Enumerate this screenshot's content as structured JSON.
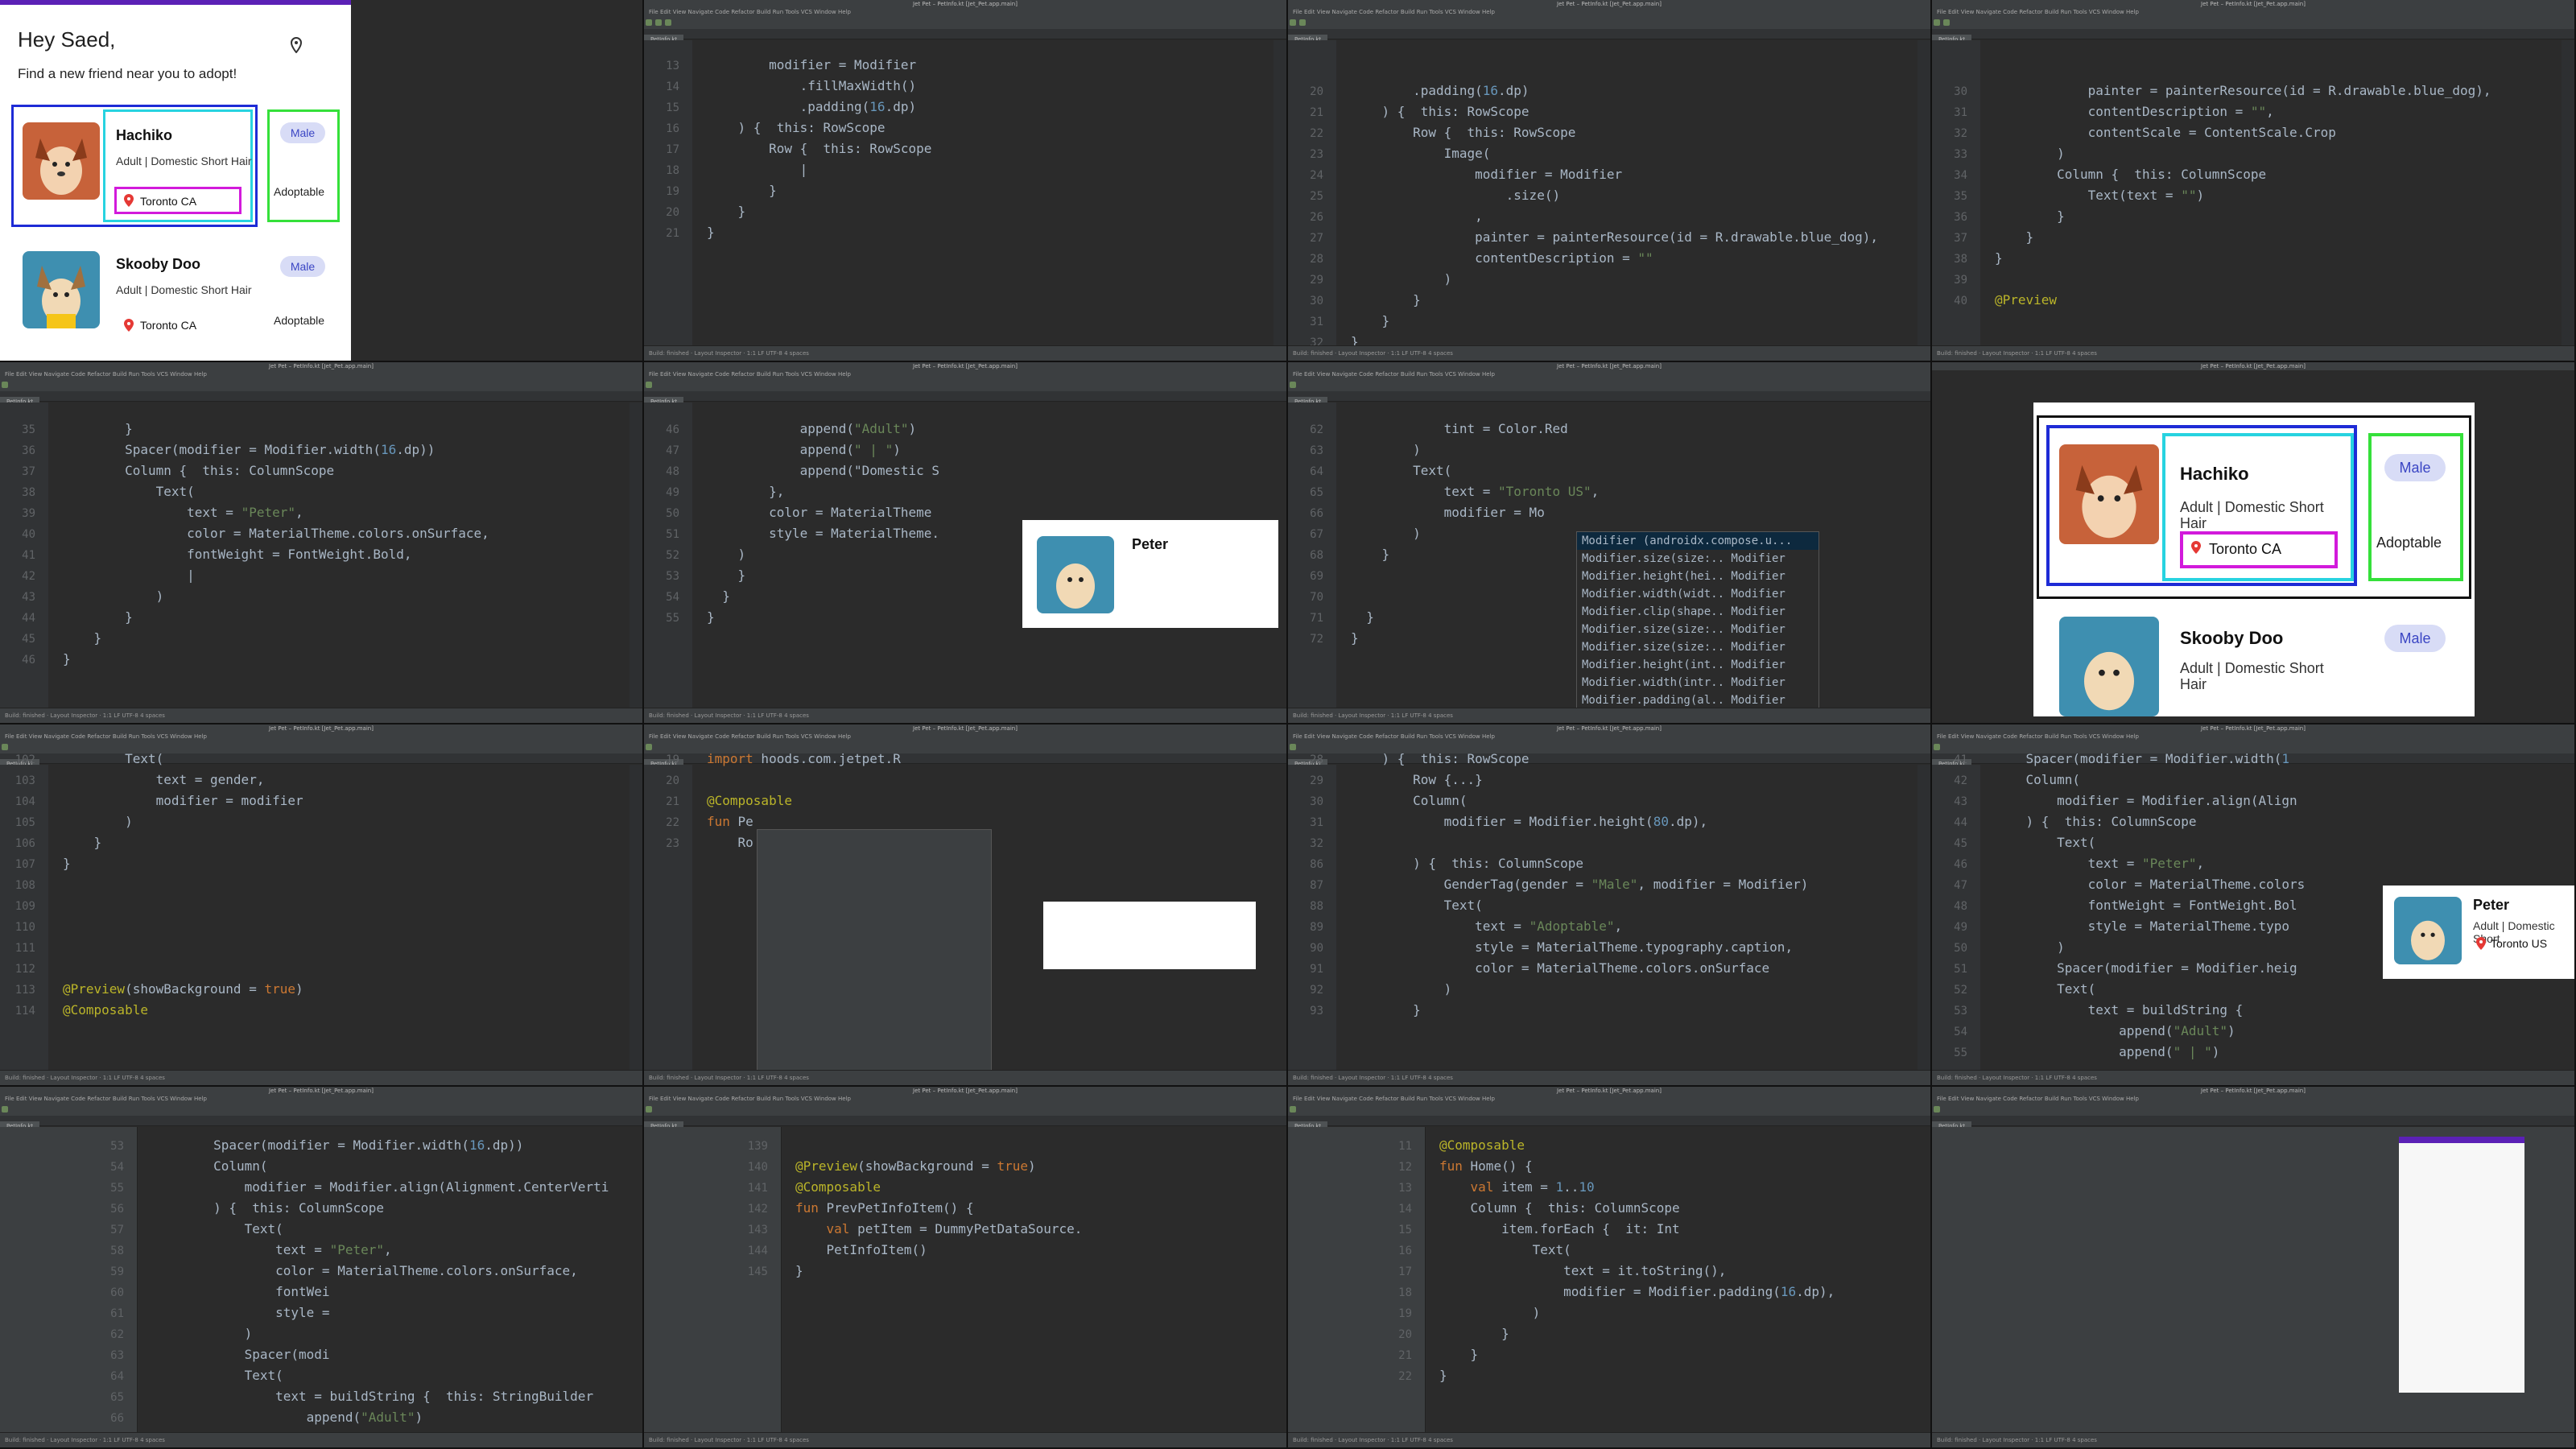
{
  "app": {
    "greeting": "Hey Saed,",
    "subtitle": "Find a new friend near you to adopt!",
    "pets": [
      {
        "name": "Hachiko",
        "desc": "Adult | Domestic Short Hair",
        "location": "Toronto CA",
        "gender": "Male",
        "status": "Adoptable"
      },
      {
        "name": "Skooby Doo",
        "desc": "Adult | Domestic Short Hair",
        "location": "Toronto CA",
        "gender": "Male",
        "status": "Adoptable"
      }
    ]
  },
  "editor": {
    "window_title": "Jet Pet – PetInfo.kt [Jet_Pet.app.main]",
    "menu": "File  Edit  View  Navigate  Code  Refactor  Build  Run  Tools  VCS  Window  Help",
    "tab": "PetInfo.kt",
    "status": "Build: finished · Layout Inspector · 1:1 LF UTF-8 4 spaces"
  },
  "panels": {
    "p1": [
      {
        "n": "13",
        "t": "        modifier = Modifier"
      },
      {
        "n": "14",
        "t": "            .fillMaxWidth()"
      },
      {
        "n": "15",
        "t": "            .padding(16.dp)"
      },
      {
        "n": "16",
        "t": "    ) {  this: RowScope"
      },
      {
        "n": "17",
        "t": "        Row {  this: RowScope"
      },
      {
        "n": "18",
        "t": "            |"
      },
      {
        "n": "19",
        "t": "        }"
      },
      {
        "n": "20",
        "t": "    }"
      },
      {
        "n": "21",
        "t": "}"
      }
    ],
    "p2": [
      {
        "n": "20",
        "t": "        .padding(16.dp)"
      },
      {
        "n": "21",
        "t": "    ) {  this: RowScope"
      },
      {
        "n": "22",
        "t": "        Row {  this: RowScope"
      },
      {
        "n": "23",
        "t": "            Image("
      },
      {
        "n": "24",
        "t": "                modifier = Modifier"
      },
      {
        "n": "25",
        "t": "                    .size()"
      },
      {
        "n": "26",
        "t": "                ,"
      },
      {
        "n": "27",
        "t": "                painter = painterResource(id = R.drawable.blue_dog),"
      },
      {
        "n": "28",
        "t": "                contentDescription = \"\""
      },
      {
        "n": "29",
        "t": "            )"
      },
      {
        "n": "30",
        "t": "        }"
      },
      {
        "n": "31",
        "t": "    }"
      },
      {
        "n": "32",
        "t": "}"
      }
    ],
    "p3": [
      {
        "n": "30",
        "t": "            painter = painterResource(id = R.drawable.blue_dog),"
      },
      {
        "n": "31",
        "t": "            contentDescription = \"\","
      },
      {
        "n": "32",
        "t": "            contentScale = ContentScale.Crop"
      },
      {
        "n": "33",
        "t": "        )"
      },
      {
        "n": "34",
        "t": "        Column {  this: ColumnScope"
      },
      {
        "n": "35",
        "t": "            Text(text = \"\")"
      },
      {
        "n": "36",
        "t": "        }"
      },
      {
        "n": "37",
        "t": "    }"
      },
      {
        "n": "38",
        "t": "}"
      },
      {
        "n": "39",
        "t": ""
      },
      {
        "n": "40",
        "t": "@Preview"
      }
    ],
    "p4": [
      {
        "n": "35",
        "t": "        }"
      },
      {
        "n": "36",
        "t": "        Spacer(modifier = Modifier.width(16.dp))"
      },
      {
        "n": "37",
        "t": "        Column {  this: ColumnScope"
      },
      {
        "n": "38",
        "t": "            Text("
      },
      {
        "n": "39",
        "t": "                text = \"Peter\","
      },
      {
        "n": "40",
        "t": "                color = MaterialTheme.colors.onSurface,"
      },
      {
        "n": "41",
        "t": "                fontWeight = FontWeight.Bold,"
      },
      {
        "n": "42",
        "t": "                |"
      },
      {
        "n": "43",
        "t": "            )"
      },
      {
        "n": "44",
        "t": "        }"
      },
      {
        "n": "45",
        "t": "    }"
      },
      {
        "n": "46",
        "t": "}"
      }
    ],
    "p5": [
      {
        "n": "46",
        "t": "            append(\"Adult\")"
      },
      {
        "n": "47",
        "t": "            append(\" | \")"
      },
      {
        "n": "48",
        "t": "            append(\"Domestic S"
      },
      {
        "n": "49",
        "t": "        },"
      },
      {
        "n": "50",
        "t": "        color = MaterialTheme"
      },
      {
        "n": "51",
        "t": "        style = MaterialTheme."
      },
      {
        "n": "52",
        "t": "    )"
      },
      {
        "n": "53",
        "t": "    }"
      },
      {
        "n": "54",
        "t": "  }"
      },
      {
        "n": "55",
        "t": "}"
      }
    ],
    "p5_preview_name": "Peter",
    "p6": [
      {
        "n": "62",
        "t": "            tint = Color.Red"
      },
      {
        "n": "63",
        "t": "        )"
      },
      {
        "n": "64",
        "t": "        Text("
      },
      {
        "n": "65",
        "t": "            text = \"Toronto US\","
      },
      {
        "n": "66",
        "t": "            modifier = Mo"
      },
      {
        "n": "67",
        "t": "        )"
      },
      {
        "n": "68",
        "t": "    }"
      },
      {
        "n": "69",
        "t": ""
      },
      {
        "n": "70",
        "t": ""
      },
      {
        "n": "71",
        "t": "  }"
      },
      {
        "n": "72",
        "t": "}"
      }
    ],
    "p6_popup": [
      "Modifier (androidx.compose.u...",
      "Modifier.size(size:..  Modifier",
      "Modifier.height(hei..  Modifier",
      "Modifier.width(widt..  Modifier",
      "Modifier.clip(shape..  Modifier",
      "Modifier.size(size:..  Modifier",
      "Modifier.size(size:..  Modifier",
      "Modifier.height(int..  Modifier",
      "Modifier.width(intr..  Modifier",
      "Modifier.padding(al..  Modifier"
    ],
    "p7_card": {
      "name": "Hachiko",
      "desc": "Adult | Domestic Short Hair",
      "location": "Toronto CA",
      "gender": "Male",
      "status": "Adoptable",
      "name2": "Skooby Doo",
      "desc2": "Adult | Domestic Short Hair",
      "gender2": "Male"
    },
    "p8": [
      {
        "n": "102",
        "t": "        Text("
      },
      {
        "n": "103",
        "t": "            text = gender,"
      },
      {
        "n": "104",
        "t": "            modifier = modifier"
      },
      {
        "n": "105",
        "t": "        )"
      },
      {
        "n": "106",
        "t": "    }"
      },
      {
        "n": "107",
        "t": "}"
      },
      {
        "n": "108",
        "t": ""
      },
      {
        "n": "109",
        "t": ""
      },
      {
        "n": "110",
        "t": ""
      },
      {
        "n": "111",
        "t": ""
      },
      {
        "n": "112",
        "t": ""
      },
      {
        "n": "113",
        "t": "@Preview(showBackground = true)"
      },
      {
        "n": "114",
        "t": "@Composable"
      }
    ],
    "p9": [
      {
        "n": "19",
        "t": "import hoods.com.jetpet.R"
      },
      {
        "n": "20",
        "t": ""
      },
      {
        "n": "21",
        "t": "@Composable"
      },
      {
        "n": "22",
        "t": "fun Pe"
      },
      {
        "n": "23",
        "t": "    Ro"
      }
    ],
    "p10": [
      {
        "n": "28",
        "t": "    ) {  this: RowScope"
      },
      {
        "n": "29",
        "t": "        Row {...}"
      },
      {
        "n": "30",
        "t": "        Column("
      },
      {
        "n": "31",
        "t": "            modifier = Modifier.height(80.dp),"
      },
      {
        "n": "32",
        "t": ""
      },
      {
        "n": "86",
        "t": "        ) {  this: ColumnScope"
      },
      {
        "n": "87",
        "t": "            GenderTag(gender = \"Male\", modifier = Modifier)"
      },
      {
        "n": "88",
        "t": "            Text("
      },
      {
        "n": "89",
        "t": "                text = \"Adoptable\","
      },
      {
        "n": "90",
        "t": "                style = MaterialTheme.typography.caption,"
      },
      {
        "n": "91",
        "t": "                color = MaterialTheme.colors.onSurface"
      },
      {
        "n": "92",
        "t": "            )"
      },
      {
        "n": "93",
        "t": "        }"
      }
    ],
    "p11": [
      {
        "n": "41",
        "t": "    Spacer(modifier = Modifier.width(1"
      },
      {
        "n": "42",
        "t": "    Column("
      },
      {
        "n": "43",
        "t": "        modifier = Modifier.align(Align"
      },
      {
        "n": "44",
        "t": "    ) {  this: ColumnScope"
      },
      {
        "n": "45",
        "t": "        Text("
      },
      {
        "n": "46",
        "t": "            text = \"Peter\","
      },
      {
        "n": "47",
        "t": "            color = MaterialTheme.colors"
      },
      {
        "n": "48",
        "t": "            fontWeight = FontWeight.Bol"
      },
      {
        "n": "49",
        "t": "            style = MaterialTheme.typo"
      },
      {
        "n": "50",
        "t": "        )"
      },
      {
        "n": "51",
        "t": "        Spacer(modifier = Modifier.heig"
      },
      {
        "n": "52",
        "t": "        Text("
      },
      {
        "n": "53",
        "t": "            text = buildString {"
      },
      {
        "n": "54",
        "t": "                append(\"Adult\")"
      },
      {
        "n": "55",
        "t": "                append(\" | \")"
      }
    ],
    "p11_preview": {
      "name": "Peter",
      "desc": "Adult | Domestic Short",
      "location": "Toronto US"
    },
    "p12": [
      {
        "n": "53",
        "t": "        Spacer(modifier = Modifier.width(16.dp))"
      },
      {
        "n": "54",
        "t": "        Column("
      },
      {
        "n": "55",
        "t": "            modifier = Modifier.align(Alignment.CenterVerti"
      },
      {
        "n": "56",
        "t": "        ) {  this: ColumnScope"
      },
      {
        "n": "57",
        "t": "            Text("
      },
      {
        "n": "58",
        "t": "                text = \"Peter\","
      },
      {
        "n": "59",
        "t": "                color = MaterialTheme.colors.onSurface,"
      },
      {
        "n": "60",
        "t": "                fontWei"
      },
      {
        "n": "61",
        "t": "                style ="
      },
      {
        "n": "62",
        "t": "            )"
      },
      {
        "n": "63",
        "t": "            Spacer(modi"
      },
      {
        "n": "64",
        "t": "            Text("
      },
      {
        "n": "65",
        "t": "                text = buildString {  this: StringBuilder"
      },
      {
        "n": "66",
        "t": "                    append(\"Adult\")"
      }
    ],
    "p13": [
      {
        "n": "139",
        "t": ""
      },
      {
        "n": "140",
        "t": "@Preview(showBackground = true)"
      },
      {
        "n": "141",
        "t": "@Composable"
      },
      {
        "n": "142",
        "t": "fun PrevPetInfoItem() {"
      },
      {
        "n": "143",
        "t": "    val petItem = DummyPetDataSource."
      },
      {
        "n": "144",
        "t": "    PetInfoItem()"
      },
      {
        "n": "145",
        "t": "}"
      }
    ],
    "p14": [
      {
        "n": "11",
        "t": "@Composable"
      },
      {
        "n": "12",
        "t": "fun Home() {"
      },
      {
        "n": "13",
        "t": "    val item = 1..10"
      },
      {
        "n": "14",
        "t": "    Column {  this: ColumnScope"
      },
      {
        "n": "15",
        "t": "        item.forEach {  it: Int"
      },
      {
        "n": "16",
        "t": "            Text("
      },
      {
        "n": "17",
        "t": "                text = it.toString(),"
      },
      {
        "n": "18",
        "t": "                modifier = Modifier.padding(16.dp),"
      },
      {
        "n": "19",
        "t": "            )"
      },
      {
        "n": "20",
        "t": "        }"
      },
      {
        "n": "21",
        "t": "    }"
      },
      {
        "n": "22",
        "t": "}"
      }
    ]
  },
  "colors": {
    "accent": "#5b21b6",
    "chip_bg": "#d8dcf6",
    "chip_text": "#3b46c4",
    "outline_blue": "#1e2bd6",
    "outline_cyan": "#27d3e0",
    "outline_green": "#35e03a",
    "outline_magenta": "#d21adb",
    "pin_red": "#e53935"
  }
}
